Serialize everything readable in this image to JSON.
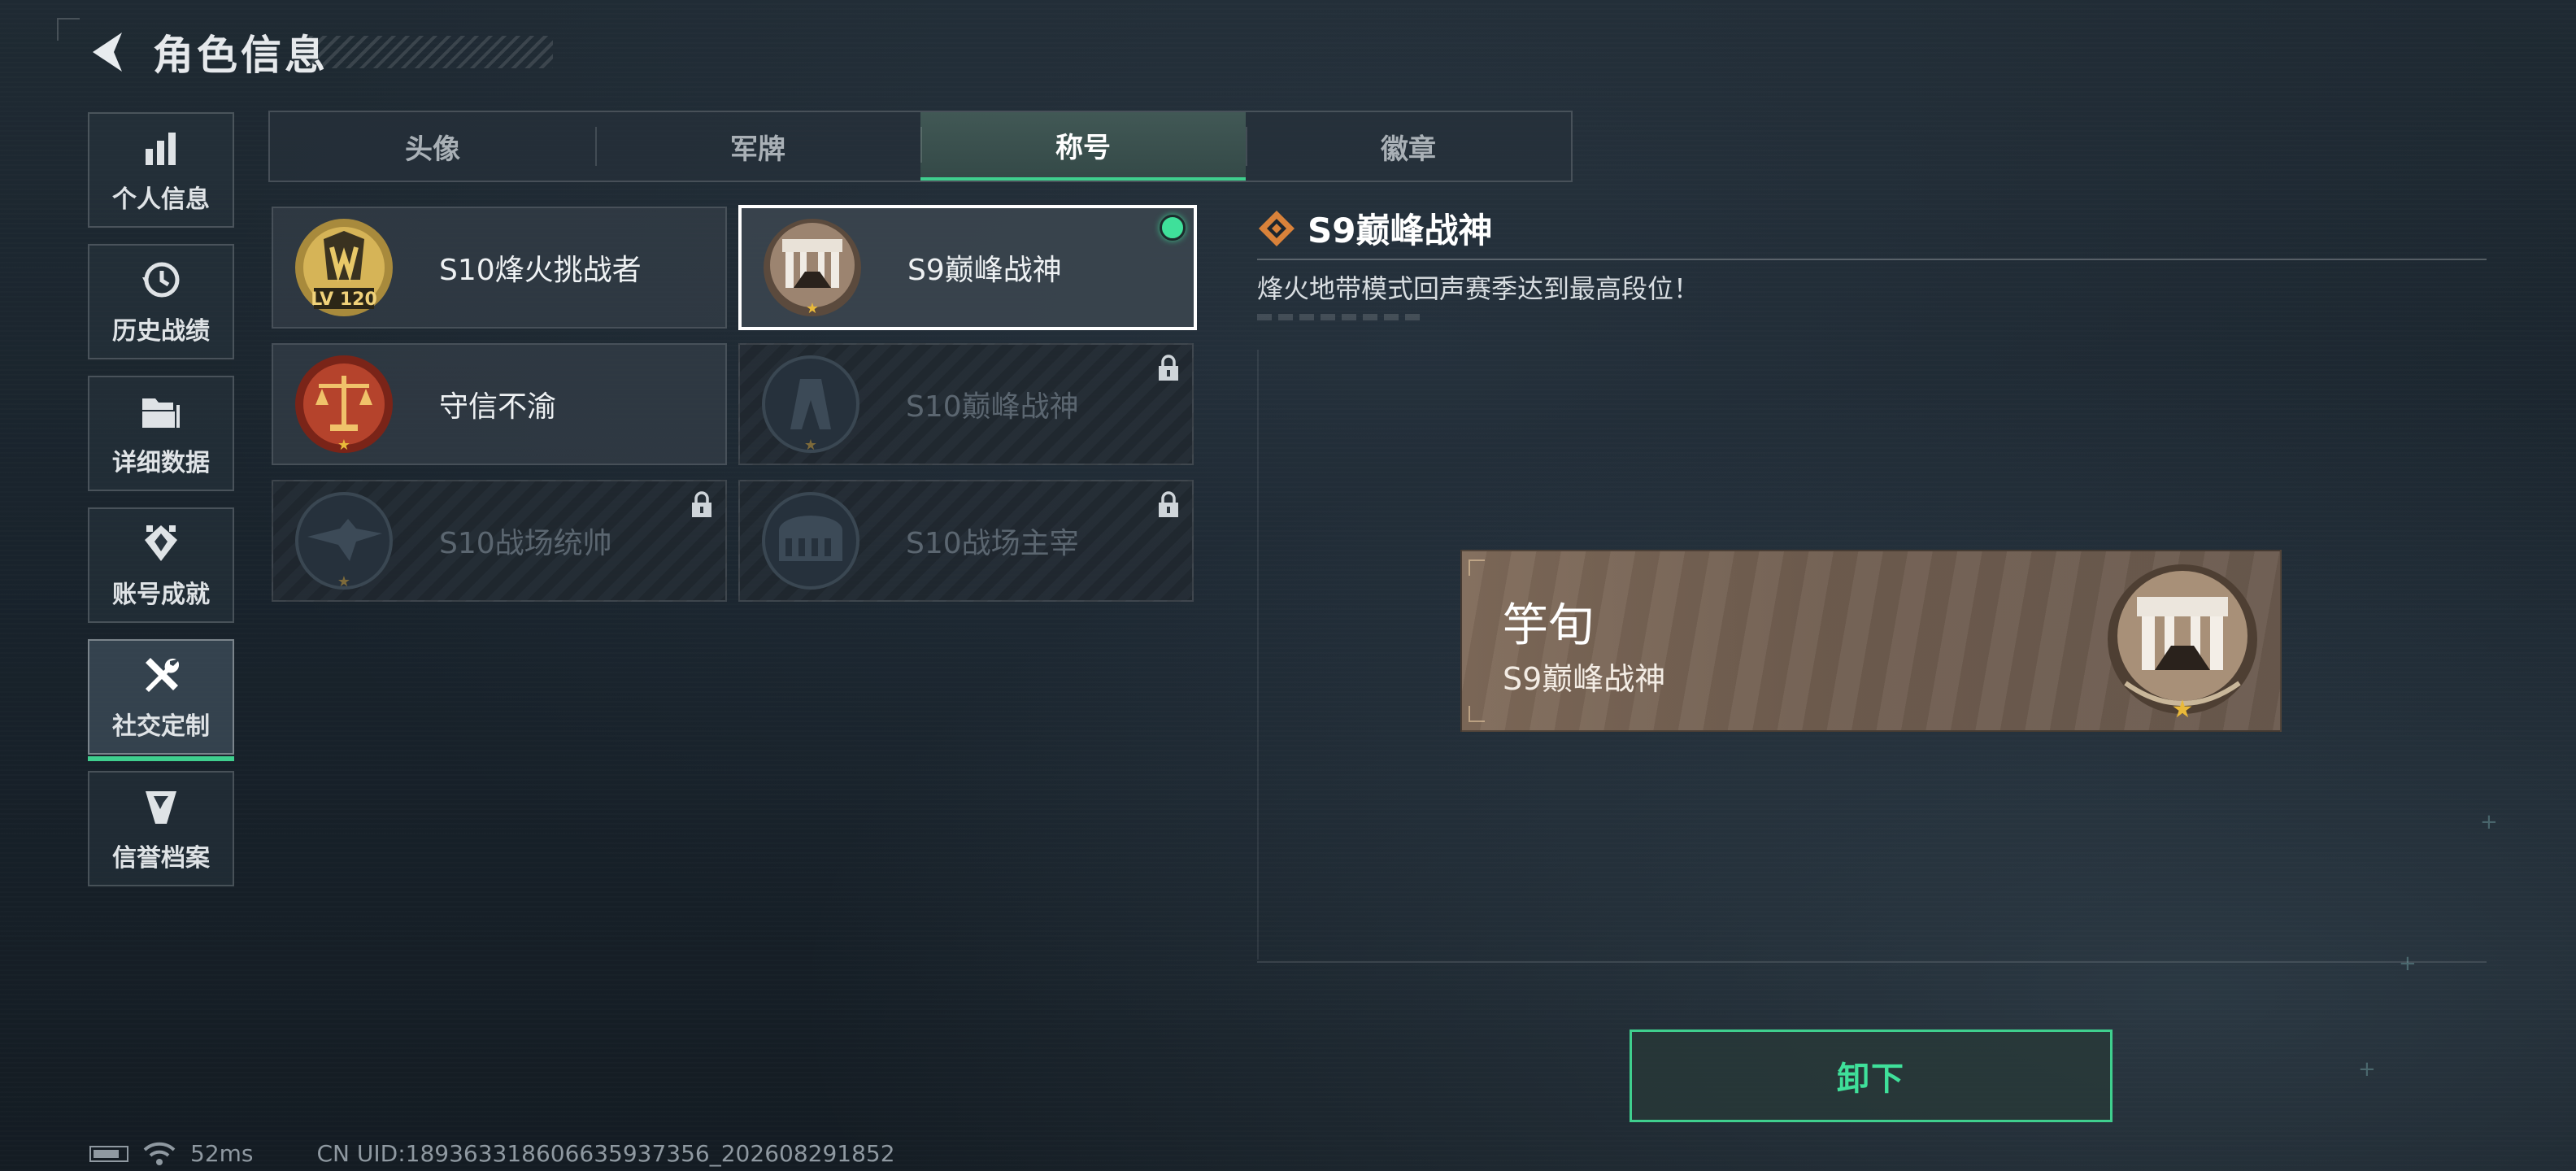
{
  "header": {
    "title": "角色信息",
    "back_icon": "back-arrow-icon"
  },
  "sidenav": {
    "items": [
      {
        "label": "个人信息",
        "icon": "bar-chart-icon",
        "active": false
      },
      {
        "label": "历史战绩",
        "icon": "history-clock-icon",
        "active": false
      },
      {
        "label": "详细数据",
        "icon": "folder-icon",
        "active": false
      },
      {
        "label": "账号成就",
        "icon": "achievement-icon",
        "active": false
      },
      {
        "label": "社交定制",
        "icon": "tools-icon",
        "active": true
      },
      {
        "label": "信誉档案",
        "icon": "credit-shield-icon",
        "active": false
      }
    ]
  },
  "tabs": [
    {
      "label": "头像",
      "active": false
    },
    {
      "label": "军牌",
      "active": false
    },
    {
      "label": "称号",
      "active": true
    },
    {
      "label": "徽章",
      "active": false
    }
  ],
  "titles": [
    {
      "label": "S10烽火挑战者",
      "locked": false,
      "selected": false,
      "badge": "lv120-gold-badge",
      "badge_text": "LV 120"
    },
    {
      "label": "S9巅峰战神",
      "locked": false,
      "selected": true,
      "equipped": true,
      "badge": "fortress-gate-badge"
    },
    {
      "label": "守信不渝",
      "locked": false,
      "selected": false,
      "badge": "scales-of-justice-badge"
    },
    {
      "label": "S10巅峰战神",
      "locked": true,
      "selected": false,
      "badge": "arch-tower-badge"
    },
    {
      "label": "S10战场统帅",
      "locked": true,
      "selected": false,
      "badge": "eagle-badge"
    },
    {
      "label": "S10战场主宰",
      "locked": true,
      "selected": false,
      "badge": "colosseum-badge"
    }
  ],
  "detail": {
    "title": "S9巅峰战神",
    "title_icon": "diamond-icon",
    "description": "烽火地带模式回声赛季达到最高段位！"
  },
  "nameplate": {
    "player_name": "竽旬",
    "title": "S9巅峰战神",
    "badge": "fortress-gate-badge"
  },
  "actions": {
    "unequip_label": "卸下"
  },
  "status": {
    "ping": "52ms",
    "uid": "CN UID:18936331860663593735​6_202608291852"
  },
  "colors": {
    "accent": "#3fcf8e",
    "equipped_dot": "#3fe09a",
    "plate_bg": "#7f6a59",
    "star": "#e9b93a"
  }
}
